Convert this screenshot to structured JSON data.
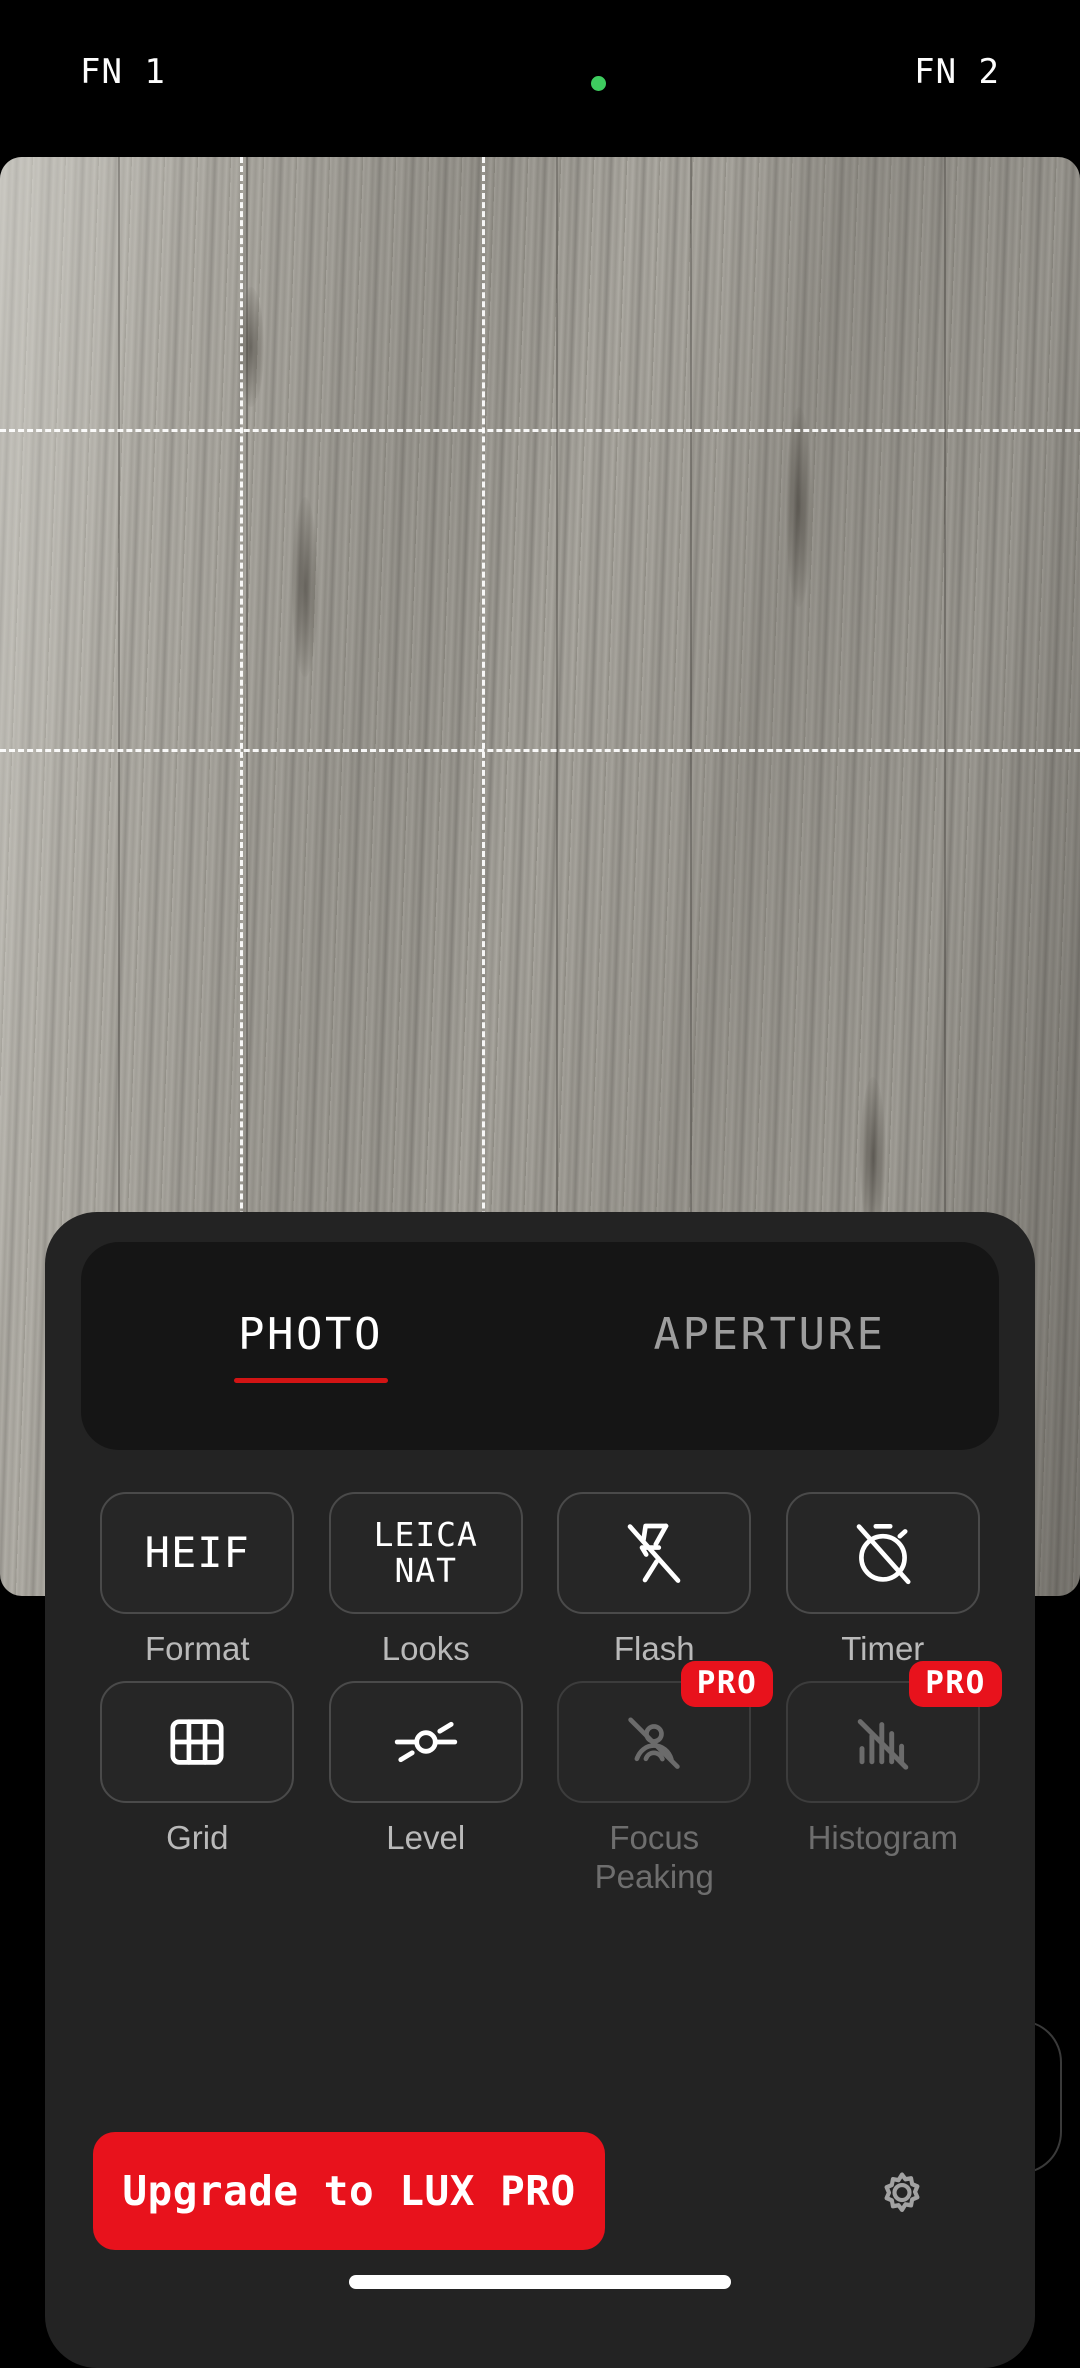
{
  "statusbar": {
    "fn1_label": "FN 1",
    "fn2_label": "FN 2",
    "privacy_indicator": "camera-in-use",
    "privacy_color": "#3ECC5F"
  },
  "viewfinder": {
    "grid_overlay": "rule-of-thirds",
    "subject": "grey wood grain surface"
  },
  "panel": {
    "tabs": [
      {
        "label": "PHOTO",
        "active": true
      },
      {
        "label": "APERTURE",
        "active": false
      }
    ],
    "accent_color": "#E8121C",
    "options": [
      {
        "label": "Format",
        "value": "HEIF",
        "icon": "text-heif",
        "type": "text",
        "pro": false,
        "enabled": true,
        "two_line": false
      },
      {
        "label": "Looks",
        "value": "LEICA\nNAT",
        "icon": "text-leica-nat",
        "type": "text",
        "pro": false,
        "enabled": true,
        "two_line": true
      },
      {
        "label": "Flash",
        "value": "",
        "icon": "flash-off-icon",
        "type": "icon",
        "pro": false,
        "enabled": true,
        "two_line": false
      },
      {
        "label": "Timer",
        "value": "",
        "icon": "timer-off-icon",
        "type": "icon",
        "pro": false,
        "enabled": true,
        "two_line": false
      },
      {
        "label": "Grid",
        "value": "",
        "icon": "grid-icon",
        "type": "icon",
        "pro": false,
        "enabled": true,
        "two_line": false
      },
      {
        "label": "Level",
        "value": "",
        "icon": "level-icon",
        "type": "icon",
        "pro": false,
        "enabled": true,
        "two_line": false
      },
      {
        "label": "Focus Peaking",
        "value": "",
        "icon": "focus-peaking-off-icon",
        "type": "icon",
        "pro": true,
        "enabled": false,
        "two_line": false
      },
      {
        "label": "Histogram",
        "value": "",
        "icon": "histogram-off-icon",
        "type": "icon",
        "pro": true,
        "enabled": false,
        "two_line": false
      }
    ],
    "pro_badge_label": "PRO",
    "upgrade_button_label": "Upgrade to LUX PRO",
    "settings_icon": "gear-icon"
  },
  "leica_line1": "LEICA",
  "leica_line2": "NAT"
}
